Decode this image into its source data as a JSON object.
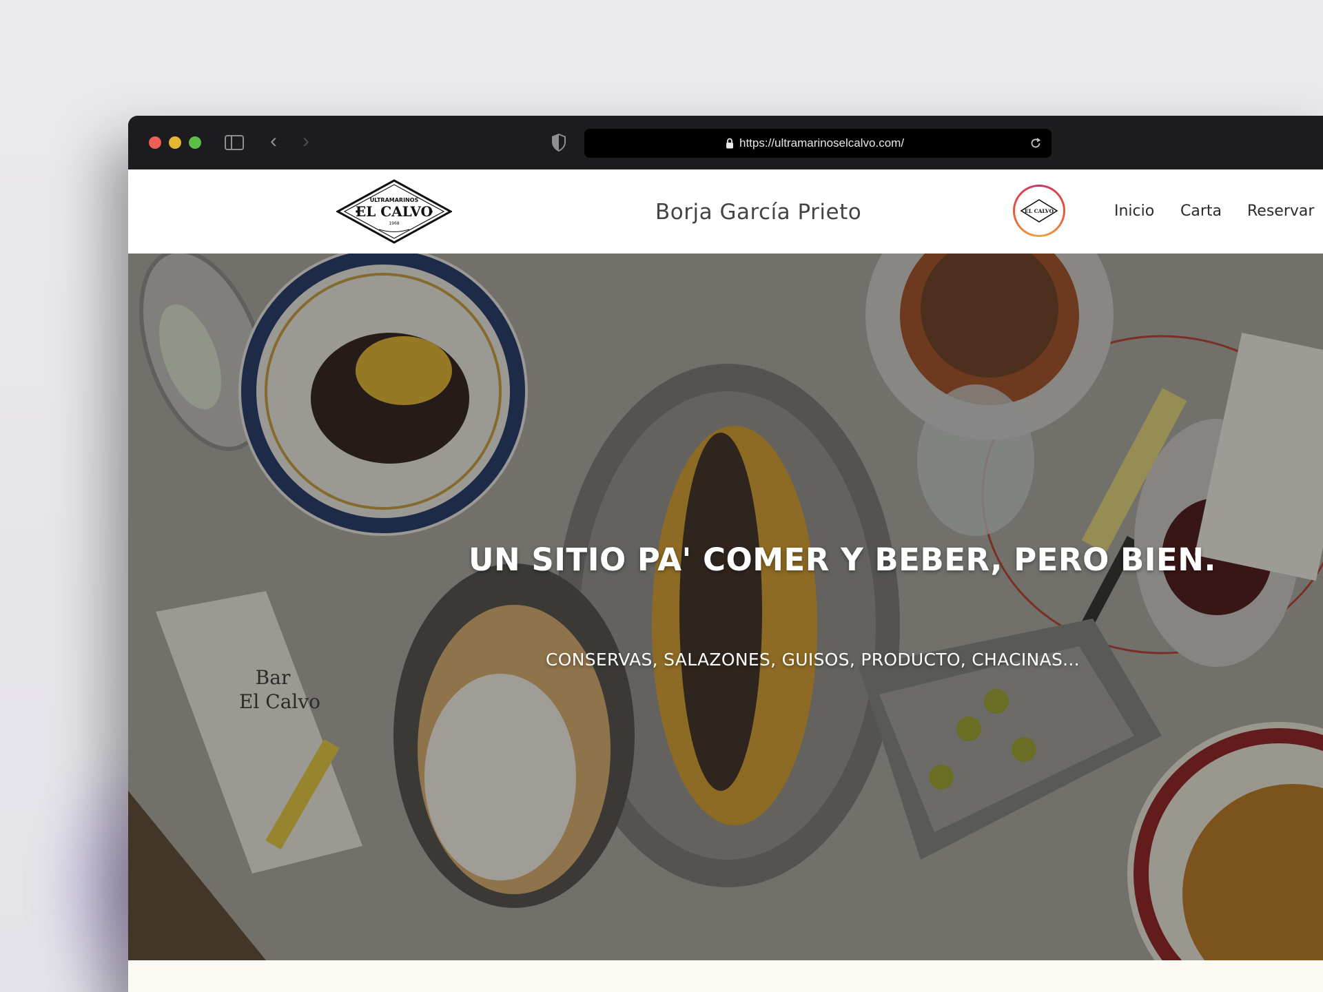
{
  "browser": {
    "url": "https://ultramarinoselcalvo.com/"
  },
  "site": {
    "logo": {
      "top_text": "ULTRAMARINOS",
      "name": "EL CALVO",
      "year": "1968"
    },
    "owner_name": "Borja García Prieto",
    "instagram_badge_text": "EL CALVO",
    "nav": {
      "inicio": "Inicio",
      "carta": "Carta",
      "reservar": "Reservar"
    }
  },
  "hero": {
    "title": "UN SITIO PA' COMER Y BEBER, PERO BIEN.",
    "subtitle": "CONSERVAS, SALAZONES, GUISOS, PRODUCTO, CHACINAS...",
    "menu_card_text": [
      "Bar",
      "El Calvo"
    ]
  },
  "icons": {
    "sidebar": "sidebar-icon",
    "back": "chevron-left-icon",
    "forward": "chevron-right-icon",
    "privacy": "shield-icon",
    "lock": "lock-icon",
    "reload": "reload-icon"
  },
  "colors": {
    "close": "#ec5f57",
    "minimize": "#e4b632",
    "zoom": "#5cc048",
    "toolbar": "#1c1c1e",
    "header": "#ffffff"
  }
}
